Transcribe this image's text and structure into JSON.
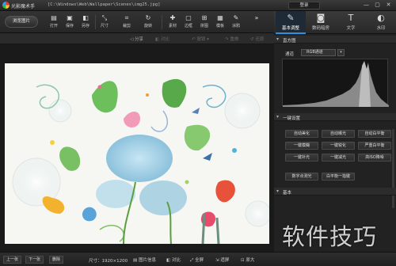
{
  "titlebar": {
    "app_name": "光影魔术手",
    "file_path": "[C:\\Windows\\Web\\Wallpaper\\Scenes\\img25.jpg]",
    "login_label": "登录",
    "minimize": "—",
    "restore": "▢",
    "close": "✕"
  },
  "toolbar": {
    "browse_label": "浏览图片",
    "tools": [
      {
        "label": "打开",
        "icon": "open-icon"
      },
      {
        "label": "保存",
        "icon": "save-icon"
      },
      {
        "label": "另存",
        "icon": "save-as-icon"
      },
      {
        "label": "尺寸",
        "icon": "resize-icon"
      },
      {
        "label": "裁剪",
        "icon": "crop-icon"
      },
      {
        "label": "旋转",
        "icon": "rotate-icon"
      },
      {
        "label": "素材",
        "icon": "material-icon"
      },
      {
        "label": "边框",
        "icon": "border-icon"
      },
      {
        "label": "拼图",
        "icon": "collage-icon"
      },
      {
        "label": "模板",
        "icon": "template-icon"
      },
      {
        "label": "涂鸦",
        "icon": "doodle-icon"
      }
    ]
  },
  "subbar": {
    "share": "分享",
    "compare": "对比",
    "redo_dropdown": "撤销",
    "undo": "重做",
    "restore": "还原"
  },
  "right_tabs": [
    {
      "label": "基本调整",
      "icon": "adjust-icon",
      "active": true
    },
    {
      "label": "数码暗房",
      "icon": "camera-icon",
      "active": false
    },
    {
      "label": "文字",
      "icon": "text-icon",
      "active": false
    },
    {
      "label": "水印",
      "icon": "watermark-icon",
      "active": false
    }
  ],
  "panel": {
    "histogram_title": "直方图",
    "channel_label": "通道",
    "channel_value": "RGB通道",
    "one_click_title": "一键设置",
    "basic_title": "基本",
    "buttons": [
      [
        "自动美化",
        "自动曝光",
        "自动白平衡"
      ],
      [
        "一键模糊",
        "一键锐化",
        "严重白平衡"
      ],
      [
        "一键补光",
        "一键减光",
        "高ISO降噪"
      ],
      [
        "数字点测光",
        "白平衡一指键"
      ]
    ]
  },
  "status": {
    "prev": "上一张",
    "next": "下一张",
    "delete": "删除",
    "size_text": "尺寸：1920×1200",
    "info": "图片信息",
    "compare": "对比",
    "fullscreen": "全屏",
    "fit": "适屏",
    "original": "原大"
  },
  "watermark_text": "软件技巧"
}
